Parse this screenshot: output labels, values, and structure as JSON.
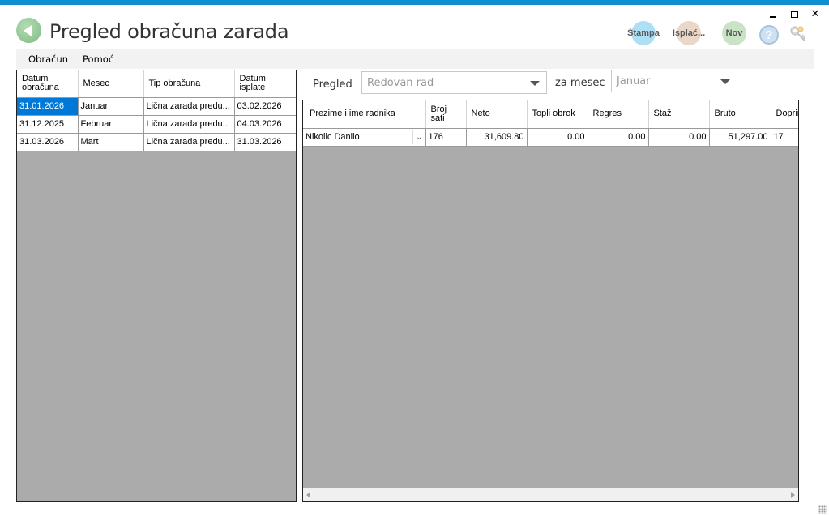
{
  "window": {
    "title": "Pregled obračuna zarada",
    "controls": {
      "minimize": "minimize-icon",
      "maximize": "maximize-icon",
      "close": "✕"
    }
  },
  "toolbar": {
    "stampa_label": "Štampa",
    "isplac_label": "Isplać...",
    "nov_label": "Nov",
    "help_label": "?",
    "colors": {
      "stampa": "#aee0f5",
      "isplac": "#ead7c8",
      "nov": "#c9e4c4",
      "back": "#7fbb83"
    }
  },
  "menu": {
    "items": [
      "Obračun",
      "Pomoć"
    ]
  },
  "left_grid": {
    "headers": [
      "Datum obračuna",
      "Mesec",
      "Tip obračuna",
      "Datum isplate"
    ],
    "rows": [
      [
        "31.01.2026",
        "Januar",
        "Lična zarada predu...",
        "03.02.2026"
      ],
      [
        "31.12.2025",
        "Februar",
        "Lična zarada predu...",
        "04.03.2026"
      ],
      [
        "31.03.2026",
        "Mart",
        "Lična zarada predu...",
        "31.03.2026"
      ]
    ]
  },
  "filters": {
    "pregled_label": "Pregled",
    "pregled_value": "Redovan rad",
    "za_mesec_label": "za mesec",
    "mesec_value": "Januar"
  },
  "right_grid": {
    "headers": [
      "Prezime i ime radnika",
      "Broj sati",
      "Neto",
      "Topli obrok",
      "Regres",
      "Staž",
      "Bruto",
      "Doprin"
    ],
    "rows": [
      [
        "Nikolic Danilo",
        "176",
        "31,609.80",
        "0.00",
        "0.00",
        "0.00",
        "51,297.00",
        "17"
      ]
    ]
  }
}
